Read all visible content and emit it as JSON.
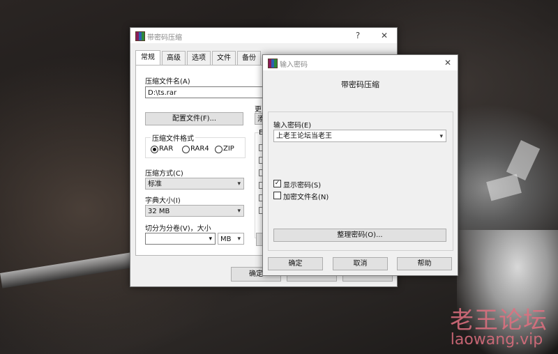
{
  "background": {
    "watermark_cn": "老王论坛",
    "watermark_en": "laowang.vip",
    "accent": "#e07080"
  },
  "main_dialog": {
    "title": "带密码压缩",
    "help_glyph": "?",
    "close_glyph": "✕",
    "tabs": [
      "常规",
      "高级",
      "选项",
      "文件",
      "备份"
    ],
    "archive_name_label": "压缩文件名(A)",
    "archive_name_value": "D:\\ts.rar",
    "profile_button": "配置文件(F)...",
    "update_label_partial": "更",
    "update_combo_partial": "添",
    "format_group_label": "压缩文件格式",
    "formats": [
      "RAR",
      "RAR4",
      "ZIP"
    ],
    "selected_format": "RAR",
    "method_label": "压缩方式(C)",
    "method_value": "标准",
    "dict_label": "字典大小(I)",
    "dict_value": "32 MB",
    "split_label": "切分为分卷(V)，大小",
    "split_value": "",
    "split_unit": "MB",
    "options_group_partial": "E",
    "ok_button": "确定"
  },
  "password_dialog": {
    "title": "输入密码",
    "header": "带密码压缩",
    "password_label": "输入密码(E)",
    "password_value": "上老王论坛当老王",
    "show_password_label": "显示密码(S)",
    "show_password_checked": true,
    "show_password_mark": "✓",
    "encrypt_names_label": "加密文件名(N)",
    "encrypt_names_checked": false,
    "organize_button": "整理密码(O)...",
    "ok_button": "确定",
    "cancel_button": "取消",
    "help_button": "帮助",
    "close_glyph": "✕"
  },
  "icons": {
    "dropdown": "▾"
  }
}
